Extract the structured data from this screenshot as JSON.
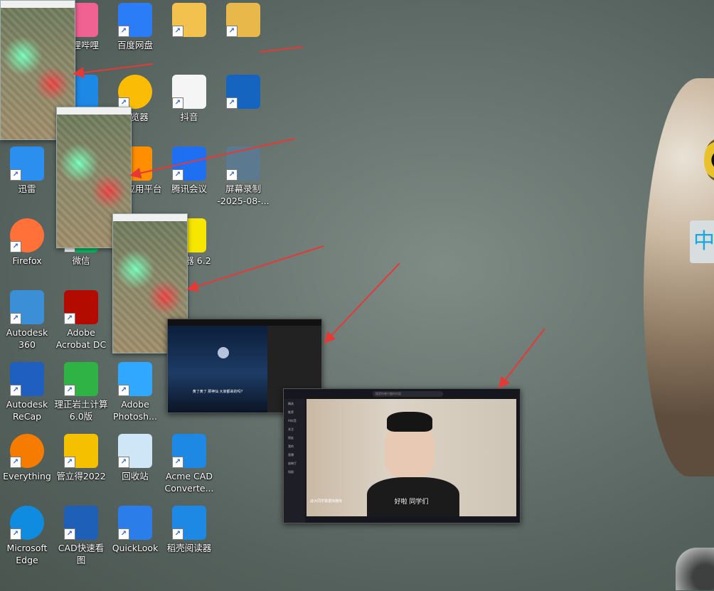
{
  "desktop_icons": [
    {
      "label": "哔哩哔哩",
      "icon": "bilibili-icon",
      "color": "#f06292"
    },
    {
      "label": "百度网盘",
      "icon": "baidu-netdisk-icon",
      "color": "#2a7cf7"
    },
    {
      "label": "",
      "icon": "folder-icon",
      "color": "#f2c14e"
    },
    {
      "label": "",
      "icon": "folder-icon",
      "color": "#e8b84a"
    },
    {
      "label": "",
      "icon": "blue-app-icon",
      "color": "#1e88e5"
    },
    {
      "label": "浏览器",
      "icon": "chrome-icon",
      "color": "#fbbc05"
    },
    {
      "label": "抖音",
      "icon": "douyin-file-icon",
      "color": "#f5f5f5"
    },
    {
      "label": "",
      "icon": "document-icon",
      "color": "#1565c0"
    },
    {
      "label": "迅雷",
      "icon": "xunlei-icon",
      "color": "#2b8ff0"
    },
    {
      "label": "增值应用平台",
      "icon": "app-platform-icon",
      "color": "#ff8f00"
    },
    {
      "label": "腾讯会议",
      "icon": "tencent-meeting-icon",
      "color": "#1e6ff1"
    },
    {
      "label": "屏幕录制 -2025-08-...",
      "icon": "video-thumbnail-icon",
      "color": "#5b7a8f"
    },
    {
      "label": "Firefox",
      "icon": "firefox-icon",
      "color": "#ff7139"
    },
    {
      "label": "微信",
      "icon": "wechat-icon",
      "color": "#07c160"
    },
    {
      "label": "求解器 6.2",
      "icon": "solver-icon",
      "color": "#f7e600"
    },
    {
      "label": "Autodesk 360",
      "icon": "autodesk-360-icon",
      "color": "#3a8fd6"
    },
    {
      "label": "Adobe Acrobat DC",
      "icon": "acrobat-icon",
      "color": "#b30b00"
    },
    {
      "label": "Autodesk ReCap",
      "icon": "recap-icon",
      "color": "#1f5fbf"
    },
    {
      "label": "理正岩土计算 6.0版",
      "icon": "lizheng-icon",
      "color": "#2fb344"
    },
    {
      "label": "Adobe Photosh...",
      "icon": "photoshop-icon",
      "color": "#31a8ff"
    },
    {
      "label": "Everything",
      "icon": "everything-search-icon",
      "color": "#f57c00"
    },
    {
      "label": "管立得2022",
      "icon": "guanlide-icon",
      "color": "#f5c000"
    },
    {
      "label": "回收站",
      "icon": "recycle-bin-icon",
      "color": "#cfe6f7"
    },
    {
      "label": "Acme CAD Converte...",
      "icon": "acme-cad-icon",
      "color": "#1e88e5"
    },
    {
      "label": "Microsoft Edge",
      "icon": "edge-icon",
      "color": "#0f8ce0"
    },
    {
      "label": "CAD快速看图",
      "icon": "cad-viewer-icon",
      "color": "#1e5fb8"
    },
    {
      "label": "QuickLook",
      "icon": "quicklook-icon",
      "color": "#2b7de9"
    },
    {
      "label": "稻壳阅读器",
      "icon": "docer-reader-icon",
      "color": "#1e88e5"
    }
  ],
  "background": {
    "badge_text": "中"
  },
  "windows": {
    "video_small": {
      "caption": "黄了黄了 那神仙 大家都来的吗?"
    },
    "douyin": {
      "search_placeholder": "搜索你感兴趣的内容",
      "subtitle": "好啦 同学们",
      "author": "@大同学数据库删库",
      "sidebar": [
        "精选",
        "推荐",
        "AI抖音",
        "关注",
        "朋友",
        "我的",
        "直播",
        "放映厅",
        "短剧"
      ]
    }
  },
  "colors": {
    "arrow": "#e53935"
  }
}
